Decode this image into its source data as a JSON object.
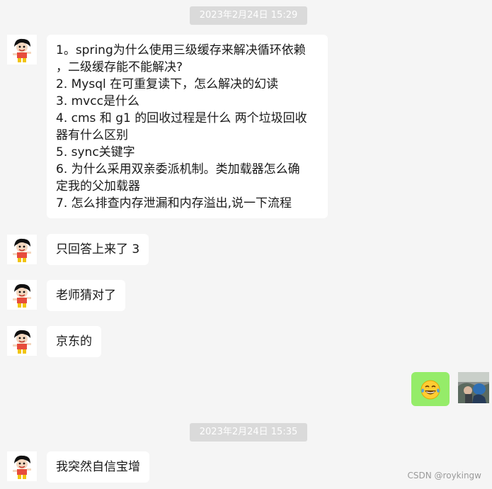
{
  "chat": {
    "timestamp_1": "2023年2月24日 15:29",
    "timestamp_2": "2023年2月24日 15:35",
    "message_1_lines": [
      "1。spring为什么使用三级缓存来解决循环依赖",
      "，二级缓存能不能解决?",
      "2. Mysql 在可重复读下，怎么解决的幻读",
      "3. mvcc是什么",
      "4. cms 和 g1 的回收过程是什么 两个垃圾回收",
      "器有什么区别",
      "5. sync关键字",
      "6. 为什么采用双亲委派机制。类加载器怎么确",
      "定我的父加载器",
      "7. 怎么排查内存泄漏和内存溢出,说一下流程"
    ],
    "message_2": "只回答上来了 3",
    "message_3": "老师猜对了",
    "message_4": "京东的",
    "self_message_icon": "tears-of-joy-emoji-icon",
    "message_5": "我突然自信宝增"
  },
  "watermark": "CSDN @roykingw",
  "colors": {
    "background": "#f5f5f5",
    "bubble_other": "#ffffff",
    "bubble_self": "#95ec69",
    "timestamp_bg": "#dadada"
  }
}
